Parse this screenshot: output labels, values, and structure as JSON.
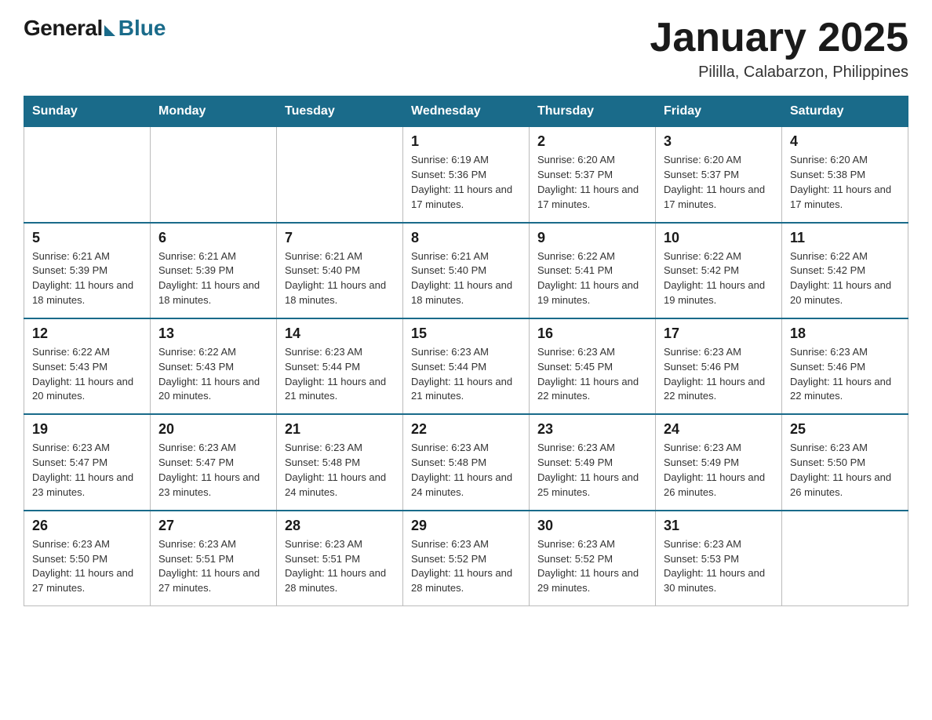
{
  "header": {
    "logo_general": "General",
    "logo_blue": "Blue",
    "title": "January 2025",
    "subtitle": "Pililla, Calabarzon, Philippines"
  },
  "days_of_week": [
    "Sunday",
    "Monday",
    "Tuesday",
    "Wednesday",
    "Thursday",
    "Friday",
    "Saturday"
  ],
  "weeks": [
    [
      {
        "day": "",
        "info": ""
      },
      {
        "day": "",
        "info": ""
      },
      {
        "day": "",
        "info": ""
      },
      {
        "day": "1",
        "info": "Sunrise: 6:19 AM\nSunset: 5:36 PM\nDaylight: 11 hours and 17 minutes."
      },
      {
        "day": "2",
        "info": "Sunrise: 6:20 AM\nSunset: 5:37 PM\nDaylight: 11 hours and 17 minutes."
      },
      {
        "day": "3",
        "info": "Sunrise: 6:20 AM\nSunset: 5:37 PM\nDaylight: 11 hours and 17 minutes."
      },
      {
        "day": "4",
        "info": "Sunrise: 6:20 AM\nSunset: 5:38 PM\nDaylight: 11 hours and 17 minutes."
      }
    ],
    [
      {
        "day": "5",
        "info": "Sunrise: 6:21 AM\nSunset: 5:39 PM\nDaylight: 11 hours and 18 minutes."
      },
      {
        "day": "6",
        "info": "Sunrise: 6:21 AM\nSunset: 5:39 PM\nDaylight: 11 hours and 18 minutes."
      },
      {
        "day": "7",
        "info": "Sunrise: 6:21 AM\nSunset: 5:40 PM\nDaylight: 11 hours and 18 minutes."
      },
      {
        "day": "8",
        "info": "Sunrise: 6:21 AM\nSunset: 5:40 PM\nDaylight: 11 hours and 18 minutes."
      },
      {
        "day": "9",
        "info": "Sunrise: 6:22 AM\nSunset: 5:41 PM\nDaylight: 11 hours and 19 minutes."
      },
      {
        "day": "10",
        "info": "Sunrise: 6:22 AM\nSunset: 5:42 PM\nDaylight: 11 hours and 19 minutes."
      },
      {
        "day": "11",
        "info": "Sunrise: 6:22 AM\nSunset: 5:42 PM\nDaylight: 11 hours and 20 minutes."
      }
    ],
    [
      {
        "day": "12",
        "info": "Sunrise: 6:22 AM\nSunset: 5:43 PM\nDaylight: 11 hours and 20 minutes."
      },
      {
        "day": "13",
        "info": "Sunrise: 6:22 AM\nSunset: 5:43 PM\nDaylight: 11 hours and 20 minutes."
      },
      {
        "day": "14",
        "info": "Sunrise: 6:23 AM\nSunset: 5:44 PM\nDaylight: 11 hours and 21 minutes."
      },
      {
        "day": "15",
        "info": "Sunrise: 6:23 AM\nSunset: 5:44 PM\nDaylight: 11 hours and 21 minutes."
      },
      {
        "day": "16",
        "info": "Sunrise: 6:23 AM\nSunset: 5:45 PM\nDaylight: 11 hours and 22 minutes."
      },
      {
        "day": "17",
        "info": "Sunrise: 6:23 AM\nSunset: 5:46 PM\nDaylight: 11 hours and 22 minutes."
      },
      {
        "day": "18",
        "info": "Sunrise: 6:23 AM\nSunset: 5:46 PM\nDaylight: 11 hours and 22 minutes."
      }
    ],
    [
      {
        "day": "19",
        "info": "Sunrise: 6:23 AM\nSunset: 5:47 PM\nDaylight: 11 hours and 23 minutes."
      },
      {
        "day": "20",
        "info": "Sunrise: 6:23 AM\nSunset: 5:47 PM\nDaylight: 11 hours and 23 minutes."
      },
      {
        "day": "21",
        "info": "Sunrise: 6:23 AM\nSunset: 5:48 PM\nDaylight: 11 hours and 24 minutes."
      },
      {
        "day": "22",
        "info": "Sunrise: 6:23 AM\nSunset: 5:48 PM\nDaylight: 11 hours and 24 minutes."
      },
      {
        "day": "23",
        "info": "Sunrise: 6:23 AM\nSunset: 5:49 PM\nDaylight: 11 hours and 25 minutes."
      },
      {
        "day": "24",
        "info": "Sunrise: 6:23 AM\nSunset: 5:49 PM\nDaylight: 11 hours and 26 minutes."
      },
      {
        "day": "25",
        "info": "Sunrise: 6:23 AM\nSunset: 5:50 PM\nDaylight: 11 hours and 26 minutes."
      }
    ],
    [
      {
        "day": "26",
        "info": "Sunrise: 6:23 AM\nSunset: 5:50 PM\nDaylight: 11 hours and 27 minutes."
      },
      {
        "day": "27",
        "info": "Sunrise: 6:23 AM\nSunset: 5:51 PM\nDaylight: 11 hours and 27 minutes."
      },
      {
        "day": "28",
        "info": "Sunrise: 6:23 AM\nSunset: 5:51 PM\nDaylight: 11 hours and 28 minutes."
      },
      {
        "day": "29",
        "info": "Sunrise: 6:23 AM\nSunset: 5:52 PM\nDaylight: 11 hours and 28 minutes."
      },
      {
        "day": "30",
        "info": "Sunrise: 6:23 AM\nSunset: 5:52 PM\nDaylight: 11 hours and 29 minutes."
      },
      {
        "day": "31",
        "info": "Sunrise: 6:23 AM\nSunset: 5:53 PM\nDaylight: 11 hours and 30 minutes."
      },
      {
        "day": "",
        "info": ""
      }
    ]
  ]
}
